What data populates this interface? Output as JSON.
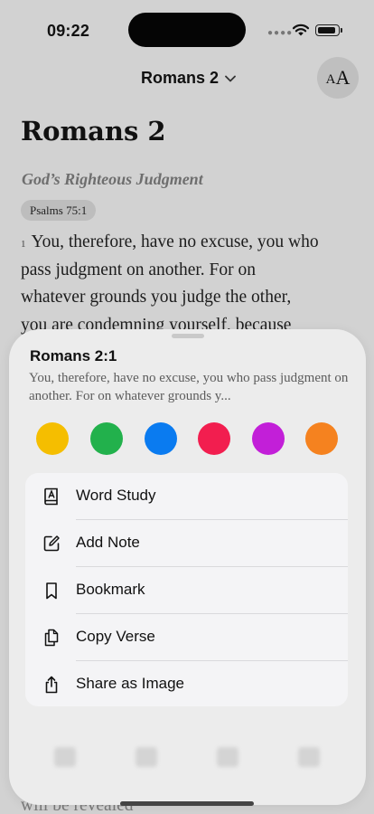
{
  "status_bar": {
    "time": "09:22"
  },
  "header": {
    "chapter": "Romans 2",
    "font_button": {
      "small": "A",
      "big": "A"
    }
  },
  "reader": {
    "title": "Romans 2",
    "section_heading": "God’s Righteous Judgment",
    "cross_reference": "Psalms 75:1",
    "verse_number": "1",
    "verse_lines": [
      "You, therefore, have no excuse, you who",
      "pass judgment on another. For on",
      "whatever grounds you judge the other,",
      "you are condemning yourself, because"
    ],
    "trailing_text": "will be revealed"
  },
  "sheet": {
    "reference": "Romans 2:1",
    "preview": "You, therefore, have no excuse, you who pass judgment on another. For on whatever grounds y...",
    "highlight_colors": [
      {
        "name": "yellow",
        "color": "#F5BE00"
      },
      {
        "name": "green",
        "color": "#22B14C"
      },
      {
        "name": "blue",
        "color": "#0A7BF0"
      },
      {
        "name": "red",
        "color": "#F21E4F"
      },
      {
        "name": "purple",
        "color": "#C21FD8"
      },
      {
        "name": "orange",
        "color": "#F5821F"
      }
    ],
    "menu": [
      {
        "label": "Word Study",
        "icon": "book-lexicon-icon"
      },
      {
        "label": "Add Note",
        "icon": "square-pencil-icon"
      },
      {
        "label": "Bookmark",
        "icon": "bookmark-icon"
      },
      {
        "label": "Copy Verse",
        "icon": "copy-document-icon"
      },
      {
        "label": "Share as Image",
        "icon": "share-icon"
      }
    ]
  }
}
